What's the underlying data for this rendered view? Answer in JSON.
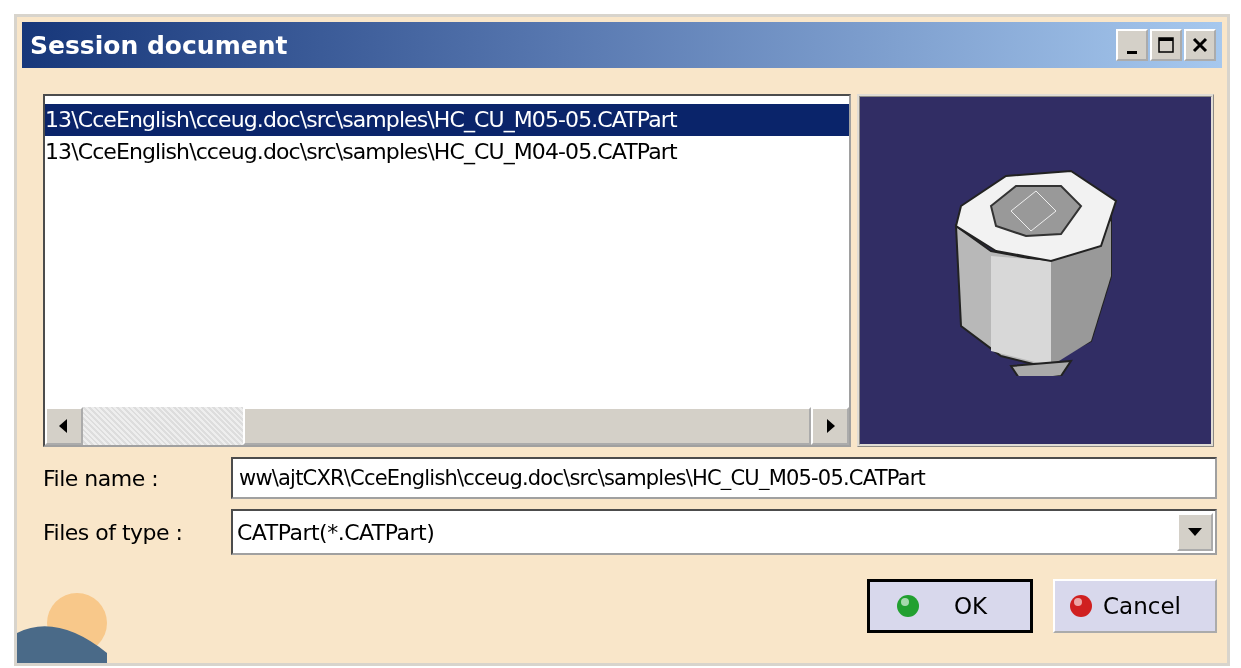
{
  "window": {
    "title": "Session document"
  },
  "file_list": {
    "items": [
      {
        "label": "13\\CceEnglish\\cceug.doc\\src\\samples\\HC_CU_M05-05.CATPart",
        "selected": true
      },
      {
        "label": "13\\CceEnglish\\cceug.doc\\src\\samples\\HC_CU_M04-05.CATPart",
        "selected": false
      }
    ]
  },
  "file_name": {
    "label": "File name :",
    "value": "ww\\ajtCXR\\CceEnglish\\cceug.doc\\src\\samples\\HC_CU_M05-05.CATPart"
  },
  "file_type": {
    "label": "Files of type :",
    "value": "CATPart(*.CATPart)"
  },
  "buttons": [
    {
      "label": "OK",
      "kind": "ok"
    },
    {
      "label": "Cancel",
      "kind": "cancel"
    }
  ]
}
